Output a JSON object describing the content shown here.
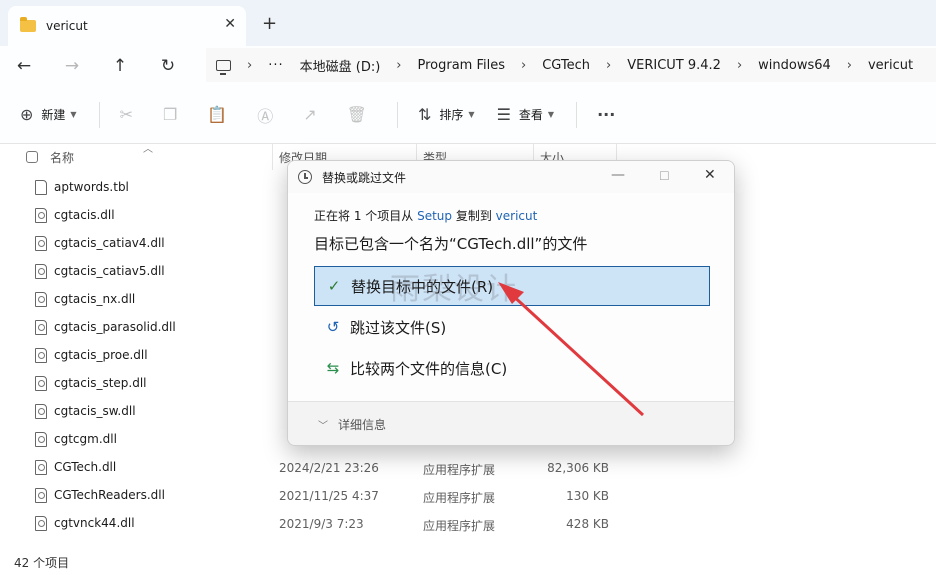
{
  "tab": {
    "title": "vericut",
    "close": "✕",
    "new_tab": "+"
  },
  "nav": {
    "back": "←",
    "forward": "→",
    "up": "↑",
    "refresh": "↻"
  },
  "address": {
    "more": "···",
    "crumbs": [
      "本地磁盘 (D:)",
      "Program Files",
      "CGTech",
      "VERICUT 9.4.2",
      "windows64",
      "vericut"
    ]
  },
  "toolbar": {
    "new_label": "新建",
    "sort_label": "排序",
    "view_label": "查看",
    "more": "···"
  },
  "columns": {
    "name": "名称",
    "date": "修改日期",
    "type": "类型",
    "size": "大小"
  },
  "files": [
    {
      "name": "aptwords.tbl",
      "date": "",
      "type": "",
      "size": ""
    },
    {
      "name": "cgtacis.dll",
      "date": "",
      "type": "",
      "size": ""
    },
    {
      "name": "cgtacis_catiav4.dll",
      "date": "",
      "type": "",
      "size": ""
    },
    {
      "name": "cgtacis_catiav5.dll",
      "date": "",
      "type": "",
      "size": ""
    },
    {
      "name": "cgtacis_nx.dll",
      "date": "",
      "type": "",
      "size": ""
    },
    {
      "name": "cgtacis_parasolid.dll",
      "date": "",
      "type": "",
      "size": ""
    },
    {
      "name": "cgtacis_proe.dll",
      "date": "",
      "type": "",
      "size": ""
    },
    {
      "name": "cgtacis_step.dll",
      "date": "",
      "type": "",
      "size": ""
    },
    {
      "name": "cgtacis_sw.dll",
      "date": "",
      "type": "",
      "size": ""
    },
    {
      "name": "cgtcgm.dll",
      "date": "",
      "type": "",
      "size": ""
    },
    {
      "name": "CGTech.dll",
      "date": "2024/2/21 23:26",
      "type": "应用程序扩展",
      "size": "82,306 KB"
    },
    {
      "name": "CGTechReaders.dll",
      "date": "2021/11/25 4:37",
      "type": "应用程序扩展",
      "size": "130 KB"
    },
    {
      "name": "cgtvnck44.dll",
      "date": "2021/9/3 7:23",
      "type": "应用程序扩展",
      "size": "428 KB"
    }
  ],
  "status": {
    "count": "42 个项目"
  },
  "dialog": {
    "title": "替换或跳过文件",
    "info_prefix": "正在将 1 个项目从 ",
    "info_source": "Setup",
    "info_middle": " 复制到 ",
    "info_dest": "vericut",
    "headline": "目标已包含一个名为“CGTech.dll”的文件",
    "opt_replace": "替换目标中的文件(R)",
    "opt_skip": "跳过该文件(S)",
    "opt_compare": "比较两个文件的信息(C)",
    "details": "详细信息"
  },
  "watermark": "雨梨设计",
  "colors": {
    "accent": "#1f63b5",
    "selection": "#cde3f6",
    "arrow": "#e0393e"
  }
}
